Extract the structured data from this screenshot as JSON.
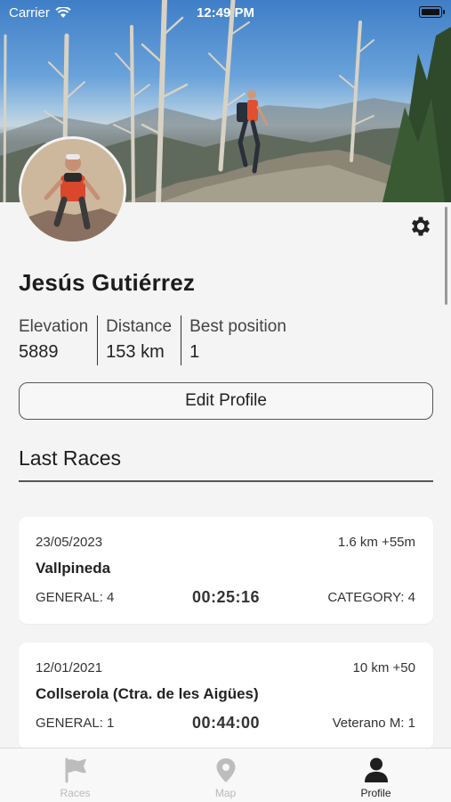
{
  "status_bar": {
    "carrier": "Carrier",
    "time": "12:49 PM"
  },
  "profile": {
    "name": "Jesús Gutiérrez",
    "stats": [
      {
        "label": "Elevation",
        "value": "5889"
      },
      {
        "label": "Distance",
        "value": "153 km"
      },
      {
        "label": "Best position",
        "value": "1"
      }
    ],
    "edit_label": "Edit Profile"
  },
  "last_races": {
    "title": "Last Races",
    "items": [
      {
        "date": "23/05/2023",
        "distance": "1.6 km +55m",
        "name": "Vallpineda",
        "general": "GENERAL: 4",
        "time": "00:25:16",
        "category": "CATEGORY: 4"
      },
      {
        "date": "12/01/2021",
        "distance": "10 km +50",
        "name": "Collserola (Ctra. de les Aigües)",
        "general": "GENERAL: 1",
        "time": "00:44:00",
        "category": "Veterano M: 1"
      }
    ]
  },
  "tabs": [
    {
      "label": "Races",
      "icon": "flag-icon",
      "active": false
    },
    {
      "label": "Map",
      "icon": "map-pin-icon",
      "active": false
    },
    {
      "label": "Profile",
      "icon": "person-icon",
      "active": true
    }
  ],
  "colors": {
    "background": "#f4f4f4",
    "card": "#ffffff",
    "text": "#1c1c1c",
    "inactive_tab": "#b9b9b9"
  }
}
